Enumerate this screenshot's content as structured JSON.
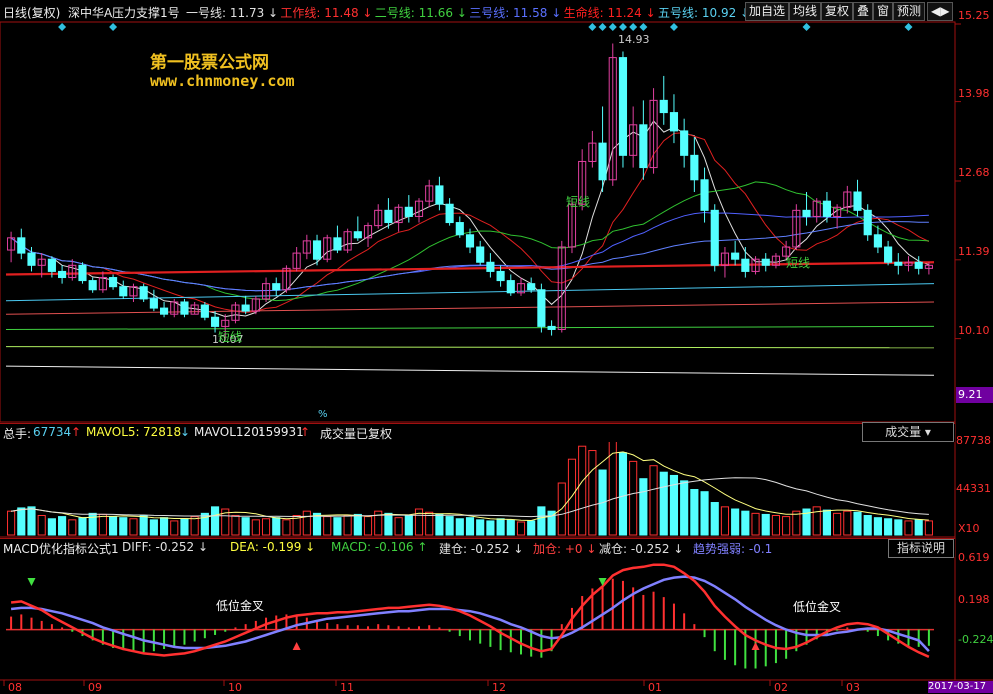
{
  "header": {
    "period": "日线(复权)",
    "stock": "深中华A",
    "indicator": "压力支撑1号",
    "lines": [
      {
        "label": "一号线:",
        "value": "11.73",
        "arrow": "↓",
        "color": "#e0e0e0"
      },
      {
        "label": "工作线:",
        "value": "11.48",
        "arrow": "↓",
        "color": "#ff3030"
      },
      {
        "label": "二号线:",
        "value": "11.66",
        "arrow": "↓",
        "color": "#40d040"
      },
      {
        "label": "三号线:",
        "value": "11.58",
        "arrow": "↓",
        "color": "#5a70ff"
      },
      {
        "label": "生命线:",
        "value": "11.24",
        "arrow": "↓",
        "color": "#ff2020"
      },
      {
        "label": "五号线:",
        "value": "10.92",
        "arrow": "↓",
        "color": "#5ad0f0"
      },
      {
        "label": "六号",
        "value": "",
        "arrow": "",
        "color": "#ff3030"
      }
    ],
    "buttons": [
      "加自选",
      "均线",
      "复权",
      "叠",
      "窗",
      "预测"
    ],
    "nav_icon": "play-back-icon"
  },
  "watermark": {
    "title": "第一股票公式网",
    "url": "www.chnmoney.com"
  },
  "price_panel": {
    "y_ticks": [
      "15.25",
      "13.98",
      "12.68",
      "11.39",
      "10.10"
    ],
    "current_price": "9.21",
    "high_label": "14.93",
    "low_label": "10.07",
    "short_labels": [
      "短线",
      "短线",
      "短线"
    ],
    "mid_marker": "%"
  },
  "volume_panel": {
    "total_label": "总手:",
    "total_value": "67734",
    "total_arrow": "↑",
    "mavol5_label": "MAVOL5:",
    "mavol5_value": "72818",
    "mavol5_arrow": "↓",
    "mavol120_label": "MAVOL120:",
    "mavol120_value": "159931",
    "mavol120_arrow": "↑",
    "note": "成交量已复权",
    "selector": "成交量",
    "y_ticks": [
      "87738",
      "44331"
    ],
    "unit": "X10"
  },
  "macd_panel": {
    "name": "MACD优化指标公式1",
    "items": [
      {
        "label": "DIFF:",
        "value": "-0.252",
        "arrow": "↓",
        "color": "#e0e0e0"
      },
      {
        "label": "DEA:",
        "value": "-0.199",
        "arrow": "↓",
        "color": "#ffff40"
      },
      {
        "label": "MACD:",
        "value": "-0.106",
        "arrow": "↑",
        "color": "#40d040"
      },
      {
        "label": "建仓:",
        "value": "-0.252",
        "arrow": "↓",
        "color": "#e0e0e0"
      },
      {
        "label": "加仓:",
        "value": "+0",
        "arrow": "↓",
        "color": "#ff4040"
      },
      {
        "label": "减仓:",
        "value": "-0.252",
        "arrow": "↓",
        "color": "#e0e0e0"
      },
      {
        "label": "趋势强弱:",
        "value": "-0.1",
        "arrow": "",
        "color": "#8080ff"
      }
    ],
    "help_button": "指标说明",
    "y_ticks": [
      "0.619",
      "0.198",
      "-0.224"
    ],
    "cross_labels": [
      "低位金叉",
      "低位金叉"
    ]
  },
  "x_axis": {
    "labels": [
      "08",
      "09",
      "10",
      "11",
      "12",
      "01",
      "02",
      "03"
    ],
    "current_date": "2017-03-17"
  },
  "colors": {
    "up": "#ff3030",
    "down": "#54ffff",
    "ma_red": "#e02020",
    "ma_green": "#30c030",
    "ma_blue": "#5060ff",
    "ma_white": "#e0e0e0"
  },
  "chart_data": {
    "type": "candlestick",
    "price_range": [
      9.21,
      15.25
    ],
    "volume_range": [
      0,
      87738
    ],
    "macd_range": [
      -0.42,
      0.68
    ],
    "candles": [
      [
        11.55,
        11.85,
        11.35,
        11.75
      ],
      [
        11.75,
        11.9,
        11.4,
        11.5
      ],
      [
        11.5,
        11.6,
        11.2,
        11.3
      ],
      [
        11.3,
        11.5,
        11.1,
        11.4
      ],
      [
        11.4,
        11.45,
        11.1,
        11.2
      ],
      [
        11.2,
        11.3,
        11.0,
        11.1
      ],
      [
        11.1,
        11.4,
        11.05,
        11.3
      ],
      [
        11.3,
        11.35,
        11.0,
        11.05
      ],
      [
        11.05,
        11.1,
        10.85,
        10.9
      ],
      [
        10.9,
        11.2,
        10.85,
        11.1
      ],
      [
        11.1,
        11.15,
        10.9,
        10.95
      ],
      [
        10.95,
        11.05,
        10.75,
        10.8
      ],
      [
        10.8,
        11.0,
        10.7,
        10.95
      ],
      [
        10.95,
        11.0,
        10.7,
        10.75
      ],
      [
        10.75,
        10.9,
        10.55,
        10.6
      ],
      [
        10.6,
        10.7,
        10.45,
        10.5
      ],
      [
        10.5,
        10.75,
        10.45,
        10.7
      ],
      [
        10.7,
        10.75,
        10.45,
        10.5
      ],
      [
        10.5,
        10.7,
        10.5,
        10.65
      ],
      [
        10.65,
        10.7,
        10.4,
        10.45
      ],
      [
        10.45,
        10.55,
        10.2,
        10.3
      ],
      [
        10.3,
        10.5,
        10.07,
        10.4
      ],
      [
        10.4,
        10.7,
        10.35,
        10.65
      ],
      [
        10.65,
        10.8,
        10.5,
        10.55
      ],
      [
        10.55,
        10.8,
        10.5,
        10.75
      ],
      [
        10.75,
        11.1,
        10.7,
        11.0
      ],
      [
        11.0,
        11.1,
        10.8,
        10.9
      ],
      [
        10.9,
        11.3,
        10.85,
        11.25
      ],
      [
        11.25,
        11.6,
        11.2,
        11.5
      ],
      [
        11.5,
        11.8,
        11.4,
        11.7
      ],
      [
        11.7,
        11.8,
        11.3,
        11.4
      ],
      [
        11.4,
        11.8,
        11.35,
        11.75
      ],
      [
        11.75,
        11.95,
        11.5,
        11.55
      ],
      [
        11.55,
        11.9,
        11.5,
        11.85
      ],
      [
        11.85,
        12.1,
        11.7,
        11.75
      ],
      [
        11.75,
        12.0,
        11.6,
        11.95
      ],
      [
        11.95,
        12.3,
        11.9,
        12.2
      ],
      [
        12.2,
        12.4,
        11.9,
        12.0
      ],
      [
        12.0,
        12.3,
        11.85,
        12.25
      ],
      [
        12.25,
        12.45,
        12.0,
        12.1
      ],
      [
        12.1,
        12.4,
        12.0,
        12.35
      ],
      [
        12.35,
        12.7,
        12.25,
        12.6
      ],
      [
        12.6,
        12.75,
        12.2,
        12.3
      ],
      [
        12.3,
        12.4,
        11.95,
        12.0
      ],
      [
        12.0,
        12.1,
        11.75,
        11.8
      ],
      [
        11.8,
        11.9,
        11.5,
        11.6
      ],
      [
        11.6,
        11.7,
        11.3,
        11.35
      ],
      [
        11.35,
        11.5,
        11.1,
        11.2
      ],
      [
        11.2,
        11.3,
        10.95,
        11.05
      ],
      [
        11.05,
        11.15,
        10.8,
        10.85
      ],
      [
        10.85,
        11.1,
        10.8,
        11.0
      ],
      [
        11.0,
        11.1,
        10.85,
        10.9
      ],
      [
        10.9,
        11.0,
        10.2,
        10.3
      ],
      [
        10.3,
        10.4,
        10.15,
        10.25
      ],
      [
        10.25,
        11.7,
        10.2,
        11.6
      ],
      [
        11.6,
        12.4,
        11.5,
        12.3
      ],
      [
        12.3,
        13.2,
        12.2,
        13.0
      ],
      [
        13.0,
        13.5,
        12.9,
        13.3
      ],
      [
        13.3,
        13.9,
        12.5,
        12.7
      ],
      [
        12.7,
        14.93,
        12.6,
        14.7
      ],
      [
        14.7,
        14.8,
        12.9,
        13.1
      ],
      [
        13.1,
        13.9,
        12.9,
        13.6
      ],
      [
        13.6,
        14.0,
        12.7,
        12.9
      ],
      [
        12.9,
        14.2,
        12.8,
        14.0
      ],
      [
        14.0,
        14.4,
        13.6,
        13.8
      ],
      [
        13.8,
        14.1,
        13.3,
        13.5
      ],
      [
        13.5,
        13.7,
        12.9,
        13.1
      ],
      [
        13.1,
        13.4,
        12.5,
        12.7
      ],
      [
        12.7,
        12.9,
        12.0,
        12.2
      ],
      [
        12.2,
        12.3,
        11.2,
        11.3
      ],
      [
        11.3,
        11.6,
        11.1,
        11.5
      ],
      [
        11.5,
        11.7,
        11.3,
        11.4
      ],
      [
        11.4,
        11.6,
        11.1,
        11.2
      ],
      [
        11.2,
        11.45,
        11.15,
        11.4
      ],
      [
        11.4,
        11.5,
        11.2,
        11.3
      ],
      [
        11.3,
        11.5,
        11.25,
        11.45
      ],
      [
        11.45,
        11.7,
        11.4,
        11.6
      ],
      [
        11.6,
        12.3,
        11.55,
        12.2
      ],
      [
        12.2,
        12.5,
        11.95,
        12.1
      ],
      [
        12.1,
        12.4,
        12.0,
        12.35
      ],
      [
        12.35,
        12.5,
        12.0,
        12.1
      ],
      [
        12.1,
        12.3,
        11.9,
        12.25
      ],
      [
        12.25,
        12.6,
        12.15,
        12.5
      ],
      [
        12.5,
        12.7,
        12.1,
        12.2
      ],
      [
        12.2,
        12.3,
        11.7,
        11.8
      ],
      [
        11.8,
        11.95,
        11.5,
        11.6
      ],
      [
        11.6,
        11.7,
        11.3,
        11.35
      ],
      [
        11.35,
        11.5,
        11.15,
        11.3
      ],
      [
        11.3,
        11.45,
        11.2,
        11.35
      ],
      [
        11.35,
        11.45,
        11.15,
        11.25
      ],
      [
        11.25,
        11.35,
        11.15,
        11.3
      ]
    ],
    "volume": [
      22000,
      25000,
      26000,
      18000,
      15000,
      17000,
      14000,
      16000,
      20000,
      19000,
      17000,
      16000,
      15000,
      18000,
      14000,
      16000,
      13000,
      15000,
      17000,
      20000,
      26000,
      24000,
      18000,
      16000,
      14000,
      15000,
      16000,
      14000,
      18000,
      22000,
      20000,
      17000,
      16000,
      18000,
      19000,
      17000,
      22000,
      20000,
      16000,
      18000,
      24000,
      21000,
      19000,
      17000,
      15000,
      16000,
      14000,
      13000,
      15000,
      14000,
      12000,
      13000,
      26000,
      22000,
      48000,
      70000,
      82000,
      78000,
      60000,
      87738,
      76000,
      68000,
      52000,
      64000,
      58000,
      55000,
      50000,
      42000,
      40000,
      30000,
      26000,
      24000,
      22000,
      20000,
      19000,
      18000,
      17000,
      22000,
      24000,
      26000,
      23000,
      20000,
      22000,
      21000,
      18000,
      16000,
      15000,
      14000,
      13000,
      14000,
      13000
    ],
    "macd_hist": [
      0.12,
      0.14,
      0.11,
      0.08,
      0.05,
      0.02,
      -0.02,
      -0.06,
      -0.1,
      -0.14,
      -0.17,
      -0.19,
      -0.2,
      -0.21,
      -0.2,
      -0.18,
      -0.16,
      -0.14,
      -0.11,
      -0.08,
      -0.05,
      -0.02,
      0.02,
      0.05,
      0.08,
      0.11,
      0.13,
      0.14,
      0.13,
      0.11,
      0.08,
      0.06,
      0.05,
      0.04,
      0.04,
      0.03,
      0.05,
      0.04,
      0.03,
      0.02,
      0.03,
      0.04,
      0.02,
      -0.02,
      -0.06,
      -0.1,
      -0.13,
      -0.16,
      -0.19,
      -0.21,
      -0.23,
      -0.25,
      -0.26,
      -0.2,
      0.05,
      0.2,
      0.31,
      0.38,
      0.4,
      0.47,
      0.45,
      0.39,
      0.32,
      0.35,
      0.3,
      0.24,
      0.15,
      0.05,
      -0.07,
      -0.2,
      -0.28,
      -0.33,
      -0.36,
      -0.36,
      -0.34,
      -0.31,
      -0.27,
      -0.2,
      -0.14,
      -0.09,
      -0.04,
      -0.01,
      0.02,
      0.01,
      -0.02,
      -0.06,
      -0.1,
      -0.13,
      -0.15,
      -0.16,
      -0.15
    ],
    "diff": [
      0.25,
      0.26,
      0.22,
      0.18,
      0.12,
      0.07,
      0.02,
      -0.03,
      -0.08,
      -0.12,
      -0.15,
      -0.18,
      -0.2,
      -0.22,
      -0.23,
      -0.24,
      -0.23,
      -0.22,
      -0.2,
      -0.17,
      -0.14,
      -0.11,
      -0.07,
      -0.03,
      0.01,
      0.05,
      0.08,
      0.11,
      0.13,
      0.14,
      0.15,
      0.15,
      0.16,
      0.16,
      0.17,
      0.18,
      0.19,
      0.2,
      0.2,
      0.21,
      0.22,
      0.23,
      0.22,
      0.2,
      0.17,
      0.13,
      0.08,
      0.03,
      -0.03,
      -0.08,
      -0.13,
      -0.17,
      -0.2,
      -0.18,
      -0.05,
      0.1,
      0.22,
      0.32,
      0.4,
      0.5,
      0.55,
      0.57,
      0.58,
      0.6,
      0.6,
      0.58,
      0.52,
      0.45,
      0.35,
      0.22,
      0.12,
      0.03,
      -0.05,
      -0.1,
      -0.14,
      -0.17,
      -0.18,
      -0.16,
      -0.12,
      -0.07,
      -0.02,
      0.02,
      0.05,
      0.06,
      0.05,
      0.02,
      -0.04,
      -0.1,
      -0.16,
      -0.21,
      -0.252
    ],
    "dea": [
      0.19,
      0.2,
      0.2,
      0.19,
      0.17,
      0.15,
      0.12,
      0.09,
      0.06,
      0.02,
      -0.01,
      -0.04,
      -0.07,
      -0.1,
      -0.12,
      -0.14,
      -0.16,
      -0.17,
      -0.17,
      -0.17,
      -0.16,
      -0.15,
      -0.13,
      -0.11,
      -0.08,
      -0.05,
      -0.02,
      0.01,
      0.04,
      0.06,
      0.08,
      0.1,
      0.11,
      0.12,
      0.13,
      0.14,
      0.15,
      0.16,
      0.17,
      0.17,
      0.18,
      0.19,
      0.19,
      0.19,
      0.18,
      0.17,
      0.15,
      0.12,
      0.09,
      0.05,
      0.02,
      -0.02,
      -0.06,
      -0.08,
      -0.07,
      -0.03,
      0.02,
      0.08,
      0.14,
      0.2,
      0.27,
      0.33,
      0.38,
      0.42,
      0.46,
      0.48,
      0.49,
      0.48,
      0.45,
      0.4,
      0.34,
      0.28,
      0.21,
      0.15,
      0.09,
      0.04,
      0.0,
      -0.03,
      -0.05,
      -0.05,
      -0.05,
      -0.03,
      -0.02,
      0.0,
      0.01,
      0.01,
      -0.01,
      -0.04,
      -0.07,
      -0.1,
      -0.199
    ]
  }
}
